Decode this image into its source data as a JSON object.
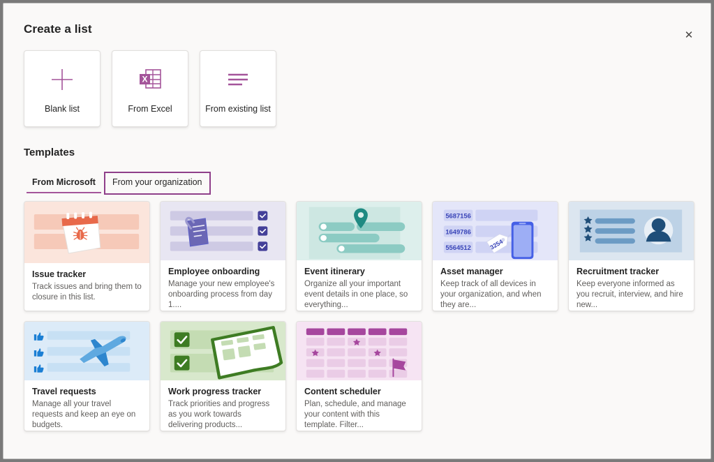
{
  "dialog": {
    "title": "Create a list",
    "close_label": "✕"
  },
  "create_options": [
    {
      "label": "Blank list",
      "icon": "plus-icon"
    },
    {
      "label": "From Excel",
      "icon": "excel-icon"
    },
    {
      "label": "From existing list",
      "icon": "existing-list-icon"
    }
  ],
  "templates_section": {
    "heading": "Templates",
    "tabs": [
      {
        "label": "From Microsoft",
        "active": true,
        "focused": false
      },
      {
        "label": "From your organization",
        "active": false,
        "focused": true
      }
    ]
  },
  "templates": [
    {
      "name": "Issue tracker",
      "description": "Track issues and bring them to closure in this list.",
      "thumb": "issue-tracker-thumb",
      "accent": "#E8694A",
      "background": "#FBE5DC"
    },
    {
      "name": "Employee onboarding",
      "description": "Manage your new employee's onboarding process from day 1....",
      "thumb": "employee-onboarding-thumb",
      "accent": "#5B5FC7",
      "background": "#E8E6F2"
    },
    {
      "name": "Event itinerary",
      "description": "Organize all your important event details in one place, so everything...",
      "thumb": "event-itinerary-thumb",
      "accent": "#1F8A82",
      "background": "#DDEFEC"
    },
    {
      "name": "Asset manager",
      "description": "Keep track of all devices in your organization, and when they are...",
      "thumb": "asset-manager-thumb",
      "accent": "#4560E6",
      "background": "#E4E6F9",
      "asset_ids": [
        "5687156",
        "1649786",
        "5564512"
      ],
      "tag_number": "3254"
    },
    {
      "name": "Recruitment tracker",
      "description": "Keep everyone informed as you recruit, interview, and hire new...",
      "thumb": "recruitment-tracker-thumb",
      "accent": "#1F4E79",
      "background": "#DCE6F0"
    },
    {
      "name": "Travel requests",
      "description": "Manage all your travel requests and keep an eye on budgets.",
      "thumb": "travel-requests-thumb",
      "accent": "#1B7FD4",
      "background": "#DCEBF8"
    },
    {
      "name": "Work progress tracker",
      "description": "Track priorities and progress as you work towards delivering products...",
      "thumb": "work-progress-tracker-thumb",
      "accent": "#3E7C23",
      "background": "#D8E8CC"
    },
    {
      "name": "Content scheduler",
      "description": "Plan, schedule, and manage your content with this template. Filter...",
      "thumb": "content-scheduler-thumb",
      "accent": "#A6479E",
      "background": "#F6E4F3"
    }
  ],
  "colors": {
    "brand_purple": "#A4549A",
    "focus_purple": "#8F3F8A",
    "dialog_background": "#faf9f8",
    "card_background": "#ffffff"
  }
}
